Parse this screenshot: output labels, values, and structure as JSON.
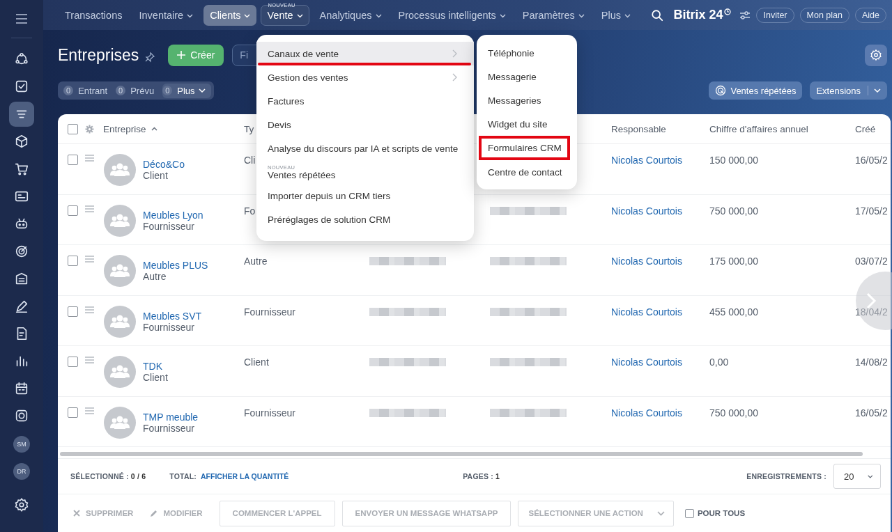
{
  "sidebar": {
    "items": [
      {
        "selected": false
      },
      {
        "selected": false
      },
      {
        "selected": true
      },
      {
        "selected": false
      },
      {
        "selected": false
      },
      {
        "selected": false
      },
      {
        "selected": false
      },
      {
        "selected": false
      },
      {
        "selected": false
      },
      {
        "selected": false
      },
      {
        "selected": false
      },
      {
        "selected": false
      },
      {
        "selected": false
      },
      {
        "selected": false
      }
    ],
    "avatars": [
      {
        "initials": "SM"
      },
      {
        "initials": "DR"
      }
    ]
  },
  "top_nav": {
    "items": [
      {
        "label": "Transactions",
        "dropdown": false,
        "selected": false,
        "open": false
      },
      {
        "label": "Inventaire",
        "dropdown": true,
        "selected": false,
        "open": false
      },
      {
        "label": "Clients",
        "dropdown": true,
        "selected": true,
        "open": false
      },
      {
        "label": "Vente",
        "dropdown": true,
        "selected": false,
        "open": true,
        "badge": "NOUVEAU"
      },
      {
        "label": "Analytiques",
        "dropdown": true,
        "selected": false,
        "open": false
      },
      {
        "label": "Processus intelligents",
        "dropdown": true,
        "selected": false,
        "open": false
      },
      {
        "label": "Paramètres",
        "dropdown": true,
        "selected": false,
        "open": false
      },
      {
        "label": "Plus",
        "dropdown": true,
        "selected": false,
        "open": false
      }
    ],
    "logo": "Bitrix 24",
    "buttons": [
      "Inviter",
      "Mon plan",
      "Aide"
    ]
  },
  "page": {
    "title": "Entreprises",
    "create_button": "Créer",
    "filter": {
      "placeholder": "Fi"
    },
    "counters": [
      {
        "count": "0",
        "label": "Entrant",
        "dropdown": false
      },
      {
        "count": "0",
        "label": "Prévu",
        "dropdown": false
      },
      {
        "count": "0",
        "label": "Plus",
        "dropdown": true
      }
    ],
    "repeat_sales_button": "Ventes répétées",
    "extensions_button": "Extensions"
  },
  "table": {
    "header_checked": false,
    "columns": [
      {
        "label": "Entreprise",
        "sorted": true
      },
      {
        "label": "Ty",
        "sorted": false
      },
      {
        "label": "Responsable",
        "sorted": false
      },
      {
        "label": "Chiffre d'affaires annuel",
        "sorted": false
      },
      {
        "label": "Créé",
        "sorted": false
      }
    ],
    "rows": [
      {
        "checked": false,
        "name": "Déco&Co",
        "subtitle": "Client",
        "type": "Cli",
        "responsible": "Nicolas Courtois",
        "revenue": "150 000,00",
        "created": "16/05/2"
      },
      {
        "checked": false,
        "name": "Meubles Lyon",
        "subtitle": "Fournisseur",
        "type": "Fo",
        "column_4": {
          "blurred": true
        },
        "responsible": "Nicolas Courtois",
        "revenue": "750 000,00",
        "created": "17/05/2"
      },
      {
        "checked": false,
        "name": "Meubles PLUS",
        "subtitle": "Autre",
        "type": "Autre",
        "column_3": {
          "blurred": true
        },
        "column_4": {
          "blurred": true
        },
        "responsible": "Nicolas Courtois",
        "revenue": "175 000,00",
        "created": "03/07/2"
      },
      {
        "checked": false,
        "name": "Meubles SVT",
        "subtitle": "Fournisseur",
        "type": "Fournisseur",
        "column_3": {
          "blurred": true
        },
        "column_4": {
          "blurred": true
        },
        "responsible": "Nicolas Courtois",
        "revenue": "455 000,00",
        "created": "18/04/2"
      },
      {
        "checked": false,
        "name": "TDK",
        "subtitle": "Client",
        "type": "Client",
        "column_3": {
          "blurred": true
        },
        "column_4": {
          "blurred": true
        },
        "responsible": "Nicolas Courtois",
        "revenue": "0,00",
        "created": "14/08/2"
      },
      {
        "checked": false,
        "name": "TMP meuble",
        "subtitle": "Fournisseur",
        "type": "Fournisseur",
        "column_3": {
          "blurred": true
        },
        "column_4": {
          "blurred": true
        },
        "responsible": "Nicolas Courtois",
        "revenue": "750 000,00",
        "created": "16/05/2"
      }
    ]
  },
  "footer": {
    "selected_label": "SÉLECTIONNÉ :",
    "selected_value": "0 / 6",
    "total_label": "TOTAL:",
    "total_link": "AFFICHER LA QUANTITÉ",
    "pages_label": "PAGES :",
    "pages_value": "1",
    "records_label": "ENREGISTREMENTS :",
    "records_value": "20"
  },
  "action_bar": [
    {
      "kind": "delete",
      "label": "SUPPRIMER"
    },
    {
      "kind": "edit",
      "label": "MODIFIER"
    },
    {
      "kind": "button",
      "label": "COMMENCER L'APPEL"
    },
    {
      "kind": "button",
      "label": "ENVOYER UN MESSAGE WHATSAPP"
    },
    {
      "kind": "select",
      "label": "SÉLECTIONNER UNE ACTION"
    },
    {
      "kind": "checkbox",
      "label": "POUR TOUS",
      "checked": false
    }
  ],
  "menu": {
    "items": [
      {
        "label": "Canaux de vente",
        "submenu": true,
        "highlighted": true,
        "annotated": true
      },
      {
        "label": "Gestion des ventes",
        "submenu": true,
        "highlighted": false,
        "annotated": false
      },
      {
        "label": "Factures",
        "submenu": false,
        "highlighted": false,
        "annotated": false
      },
      {
        "label": "Devis",
        "submenu": false,
        "highlighted": false,
        "annotated": false
      },
      {
        "label": "Analyse du discours par IA et scripts de vente",
        "submenu": false,
        "highlighted": false,
        "annotated": false
      },
      {
        "label": "Ventes répétées",
        "submenu": false,
        "highlighted": false,
        "annotated": false,
        "badge": "NOUVEAU"
      },
      {
        "label": "Importer depuis un CRM tiers",
        "submenu": false,
        "highlighted": false,
        "annotated": false
      },
      {
        "label": "Préréglages de solution CRM",
        "submenu": false,
        "highlighted": false,
        "annotated": false
      }
    ]
  },
  "submenu": {
    "items": [
      {
        "label": "Téléphonie",
        "annotated": false
      },
      {
        "label": "Messagerie",
        "annotated": false
      },
      {
        "label": "Messageries",
        "annotated": false
      },
      {
        "label": "Widget du site",
        "annotated": false
      },
      {
        "label": "Formulaires CRM",
        "annotated": true
      },
      {
        "label": "Centre de contact",
        "annotated": false
      }
    ]
  }
}
